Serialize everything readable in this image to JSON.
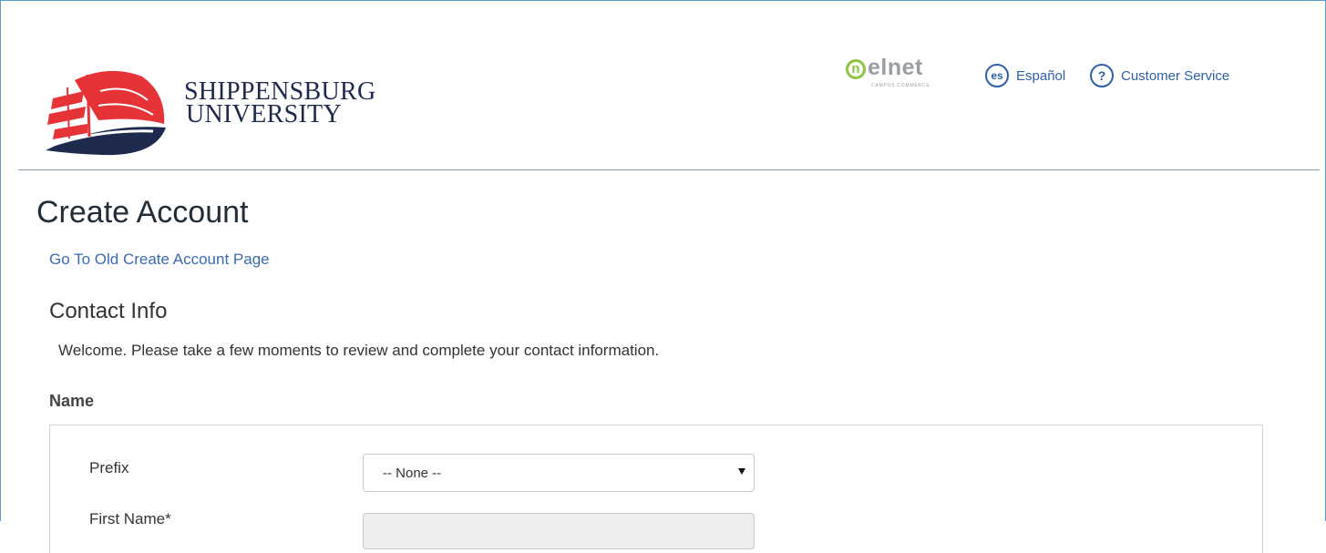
{
  "header": {
    "logo": {
      "line1": "SHIPPENSBURG",
      "line2": "UNIVERSITY"
    },
    "partner": {
      "word": "elnet",
      "mark": "n",
      "sub": "CAMPUS COMMERCE"
    },
    "language_link": {
      "icon_text": "es",
      "label": "Español"
    },
    "customer_service": {
      "icon_text": "?",
      "label": "Customer Service"
    }
  },
  "main": {
    "title": "Create Account",
    "old_page_link": "Go To Old Create Account Page",
    "section_title": "Contact Info",
    "welcome_text": "Welcome. Please take a few moments to review and complete your contact information.",
    "name_group": {
      "label": "Name",
      "fields": [
        {
          "label": "Prefix",
          "value": "-- None --"
        },
        {
          "label": "First Name*"
        }
      ]
    }
  },
  "colors": {
    "link": "#2f5fa8",
    "brand_red": "#e63338",
    "brand_navy": "#1d2a4d",
    "partner_green": "#8dc63f"
  }
}
